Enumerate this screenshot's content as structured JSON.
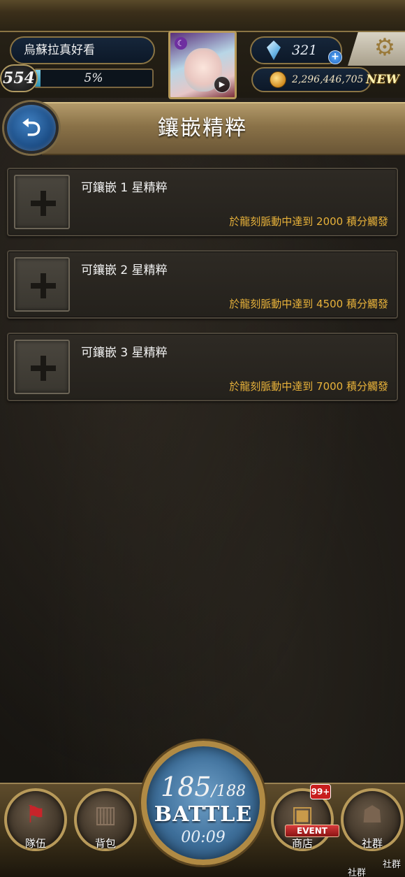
{
  "status": {
    "player_name": "烏蘇拉真好看",
    "level": "554",
    "exp_percent_text": "5%",
    "exp_fraction": 0.05,
    "gems": "321",
    "gold": "2,296,446,705",
    "new_badge": "NEW"
  },
  "page": {
    "title": "鑲嵌精粹"
  },
  "slots": [
    {
      "label": "可鑲嵌 1 星精粹",
      "requirement": "於龍刻脈動中達到 2000 積分觸發"
    },
    {
      "label": "可鑲嵌 2 星精粹",
      "requirement": "於龍刻脈動中達到 4500 積分觸發"
    },
    {
      "label": "可鑲嵌 3 星精粹",
      "requirement": "於龍刻脈動中達到 7000 積分觸發"
    }
  ],
  "nav": {
    "team": "隊伍",
    "bag": "背包",
    "battle_current": "185",
    "battle_max": "/188",
    "battle_label": "BATTLE",
    "battle_timer": "00:09",
    "shop": "商店",
    "shop_event": "EVENT",
    "shop_badge": "99+",
    "social": "社群",
    "social_extra": "社群",
    "social_extra2": "社群"
  },
  "colors": {
    "accent_gold": "#e8b23a",
    "title_band": "#8a7248",
    "battle_blue": "#3e6f9a"
  },
  "icons": {
    "back": "back-arrow-icon",
    "add": "plus-icon",
    "settings": "gear-icon",
    "gem": "gem-icon",
    "gold": "coin-icon",
    "team": "flag-icon",
    "bag": "backpack-icon",
    "shop": "treasure-chest-icon",
    "social": "people-icon"
  }
}
